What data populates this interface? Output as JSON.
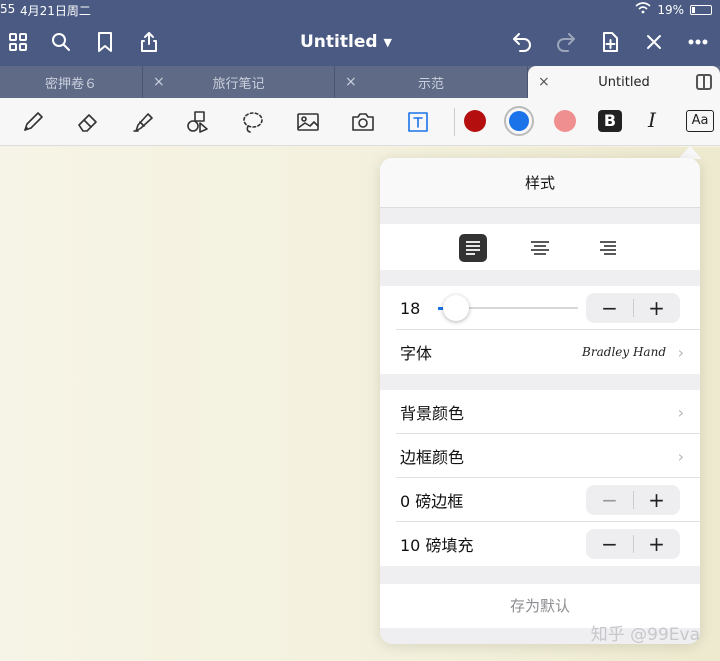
{
  "status": {
    "time": "55",
    "date": "4月21日周二",
    "battery": "19%"
  },
  "toolbar": {
    "title": "Untitled",
    "left_icons": [
      "grid-icon",
      "search-icon",
      "bookmark-icon",
      "share-icon"
    ],
    "right_icons": [
      "undo-icon",
      "redo-icon",
      "add-page-icon",
      "close-icon",
      "more-icon"
    ]
  },
  "tabs": [
    {
      "label": "密押卷６",
      "active": false
    },
    {
      "label": "旅行笔记",
      "active": false
    },
    {
      "label": "示范",
      "active": false
    },
    {
      "label": "Untitled",
      "active": true
    }
  ],
  "tools": {
    "items": [
      "pen-icon",
      "eraser-icon",
      "highlighter-icon",
      "shapes-icon",
      "lasso-icon",
      "image-icon",
      "camera-icon",
      "textbox-icon"
    ],
    "colors": [
      "#b50e0e",
      "#1a73e8",
      "#ef8f8f"
    ],
    "bold_label": "B",
    "italic_label": "I",
    "textstyle_label": "Aa"
  },
  "popover": {
    "title": "样式",
    "alignment": [
      "align-left",
      "align-center",
      "align-right"
    ],
    "font_size": "18",
    "font_size_fraction": 0.05,
    "font_label": "字体",
    "font_value": "Bradley Hand",
    "bg_color_label": "背景颜色",
    "border_color_label": "边框颜色",
    "border_label": "0 磅边框",
    "padding_label": "10 磅填充",
    "default_label": "存为默认",
    "minus": "−",
    "plus": "+"
  },
  "watermark": "知乎 @99Eva"
}
